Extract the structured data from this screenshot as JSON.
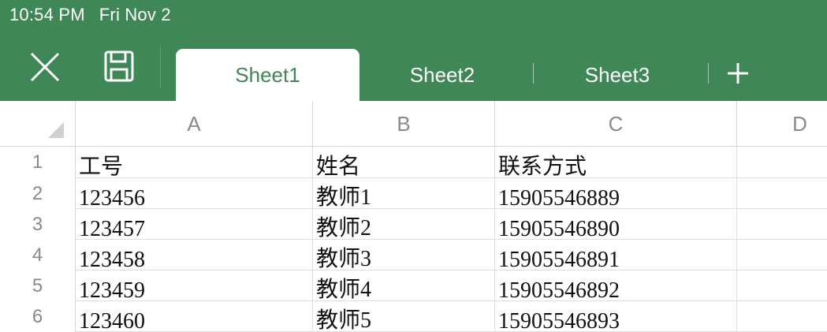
{
  "status_bar": {
    "time": "10:54 PM",
    "date": "Fri Nov 2"
  },
  "toolbar": {
    "close_icon": "close-icon",
    "save_icon": "save-icon",
    "add_icon": "plus-icon"
  },
  "tabs": [
    {
      "label": "Sheet1",
      "active": true
    },
    {
      "label": "Sheet2",
      "active": false
    },
    {
      "label": "Sheet3",
      "active": false
    }
  ],
  "colors": {
    "accent": "#3f8757",
    "header_text": "#8a8a8a",
    "gridline": "#dedede"
  },
  "columns": [
    "A",
    "B",
    "C",
    "D"
  ],
  "rows": [
    {
      "num": "1",
      "cells": [
        "工号",
        "姓名",
        "联系方式",
        ""
      ]
    },
    {
      "num": "2",
      "cells": [
        "123456",
        "教师1",
        "15905546889",
        ""
      ]
    },
    {
      "num": "3",
      "cells": [
        "123457",
        "教师2",
        "15905546890",
        ""
      ]
    },
    {
      "num": "4",
      "cells": [
        "123458",
        "教师3",
        "15905546891",
        ""
      ]
    },
    {
      "num": "5",
      "cells": [
        "123459",
        "教师4",
        "15905546892",
        ""
      ]
    },
    {
      "num": "6",
      "cells": [
        "123460",
        "教师5",
        "15905546893",
        ""
      ]
    }
  ]
}
